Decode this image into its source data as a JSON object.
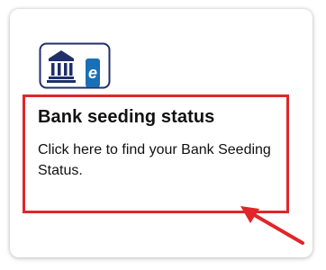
{
  "card": {
    "title": "Bank seeding status",
    "description": "Click here to find your Bank Seeding Status.",
    "logo_icon": "bank-building-icon",
    "badge_letter": "e",
    "badge_icon": "e-badge-icon"
  },
  "annotation": {
    "highlight_color": "#e0262a",
    "arrow_icon": "red-arrow-icon"
  },
  "colors": {
    "logo_navy": "#1f2f6b",
    "badge_blue": "#1a6fb5",
    "text": "#111111",
    "background": "#ffffff"
  }
}
